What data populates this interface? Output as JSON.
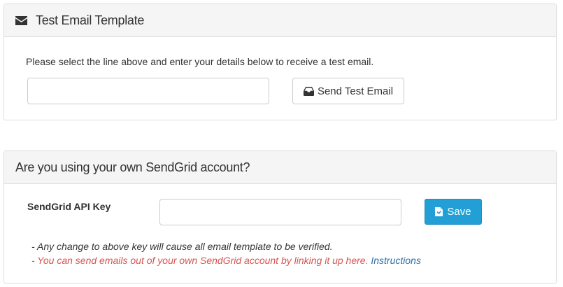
{
  "test_panel": {
    "title": "Test Email Template",
    "help_text": "Please select the line above and enter your details below to receive a test email.",
    "email_value": "",
    "send_button_label": "Send Test Email"
  },
  "sendgrid_panel": {
    "title": "Are you using your own SendGrid account?",
    "api_key_label": "SendGrid API Key",
    "api_key_value": "",
    "save_button_label": "Save",
    "note_1": "- Any change to above key will cause all email template to be verified.",
    "note_2": "- You can send emails out of your own SendGrid account by linking it up here.",
    "instructions_link": "Instructions"
  },
  "colors": {
    "panel_heading_bg": "#f5f5f5",
    "border": "#dddddd",
    "primary": "#22a0d6",
    "danger_text": "#d9534f",
    "link": "#2a6fa8"
  },
  "icons": {
    "test_panel_title": "envelope-icon",
    "send_button": "inbox-icon",
    "save_button": "file-save-icon"
  }
}
